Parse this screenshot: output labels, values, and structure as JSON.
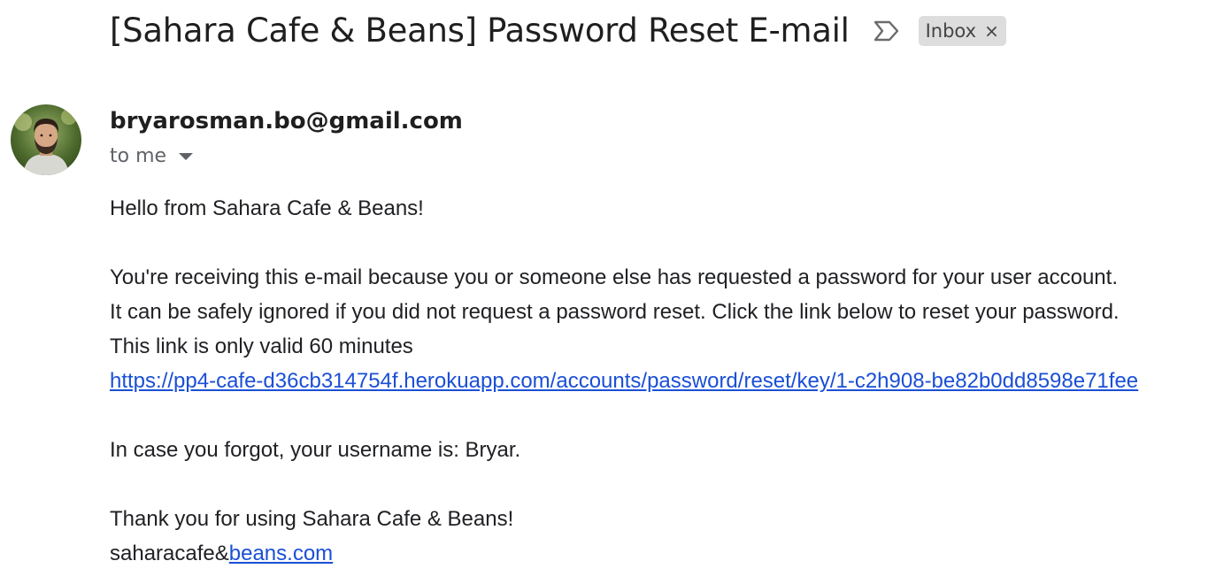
{
  "email": {
    "subject": "[Sahara Cafe & Beans] Password Reset E-mail",
    "labels": [
      {
        "name": "Inbox",
        "remove_symbol": "×"
      }
    ],
    "important_icon": "importance-marker-icon",
    "sender": "bryarosman.bo@gmail.com",
    "avatar_icon": "sender-avatar-photo",
    "recipients_label": "to me",
    "body": {
      "greeting": "Hello from Sahara Cafe & Beans!",
      "line1": "You're receiving this e-mail because you or someone else has requested a password for your user account.",
      "line2": "It can be safely ignored if you did not request a password reset. Click the link below to reset your password.",
      "line3": "This link is only valid 60 minutes",
      "reset_link": "https://pp4-cafe-d36cb314754f.herokuapp.com/accounts/password/reset/key/1-c2h908-be82b0dd8598e71fee",
      "username_line": "In case you forgot, your username is: Bryar.",
      "thanks": "Thank you for using Sahara Cafe & Beans!",
      "signature_prefix": "saharacafe&",
      "signature_link": "beans.com"
    }
  },
  "colors": {
    "link": "#1a4fd6",
    "label_chip_bg": "#dddddd",
    "muted_text": "#5f6368"
  }
}
